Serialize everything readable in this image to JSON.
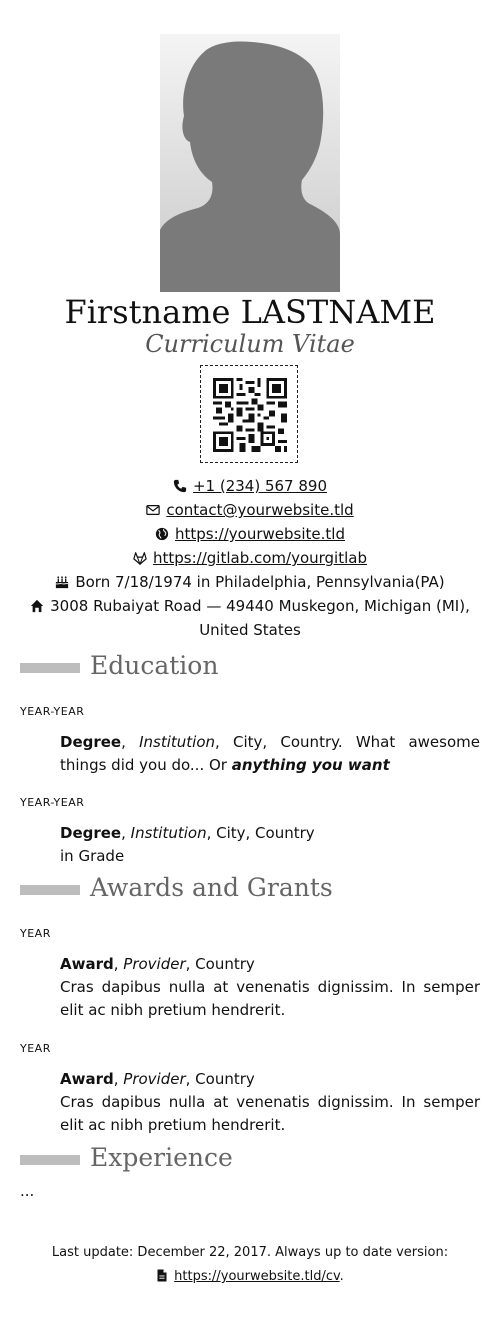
{
  "header": {
    "name": "Firstname LASTNAME",
    "subtitle": "Curriculum Vitae"
  },
  "contacts": {
    "phone": "+1 (234) 567 890",
    "email": "contact@yourwebsite.tld",
    "website": "https://yourwebsite.tld",
    "gitlab": "https://gitlab.com/yourgitlab",
    "birth": "Born 7/18/1974 in Philadelphia, Pennsylvania(PA)",
    "address_line1": "3008 Rubaiyat Road — 49440 Muskegon, Michigan (MI),",
    "address_line2": "United States"
  },
  "sections": {
    "education": {
      "title": "Education",
      "entries": [
        {
          "year": "YEAR-YEAR",
          "degree": "Degree",
          "institution": "Institution",
          "place": ", City, Country. What awesome things did you do... Or ",
          "emph": "anything you want"
        },
        {
          "year": "YEAR-YEAR",
          "degree": "Degree",
          "institution": "Institution",
          "place": ", City, Country",
          "grade": "in Grade"
        }
      ]
    },
    "awards": {
      "title": "Awards and Grants",
      "entries": [
        {
          "year": "YEAR",
          "award": "Award",
          "provider": "Provider",
          "country": ", Country",
          "desc": "Cras dapibus nulla at venenatis dignissim. In semper elit ac nibh pretium hendrerit."
        },
        {
          "year": "YEAR",
          "award": "Award",
          "provider": "Provider",
          "country": ", Country",
          "desc": "Cras dapibus nulla at venenatis dignissim. In semper elit ac nibh pretium hendrerit."
        }
      ]
    },
    "experience": {
      "title": "Experience",
      "placeholder": "..."
    }
  },
  "footer": {
    "text": "Last update: December 22, 2017. Always up to date version:",
    "link": "https://yourwebsite.tld/cv",
    "suffix": "."
  },
  "icons": {
    "phone": "phone-icon",
    "email": "envelope-icon",
    "website": "globe-icon",
    "gitlab": "gitlab-icon",
    "birth": "birthday-cake-icon",
    "address": "home-icon",
    "footer": "document-icon"
  },
  "colors": {
    "section_bar": "#bdbdbd",
    "section_title": "#666666",
    "subtitle": "#555555"
  }
}
